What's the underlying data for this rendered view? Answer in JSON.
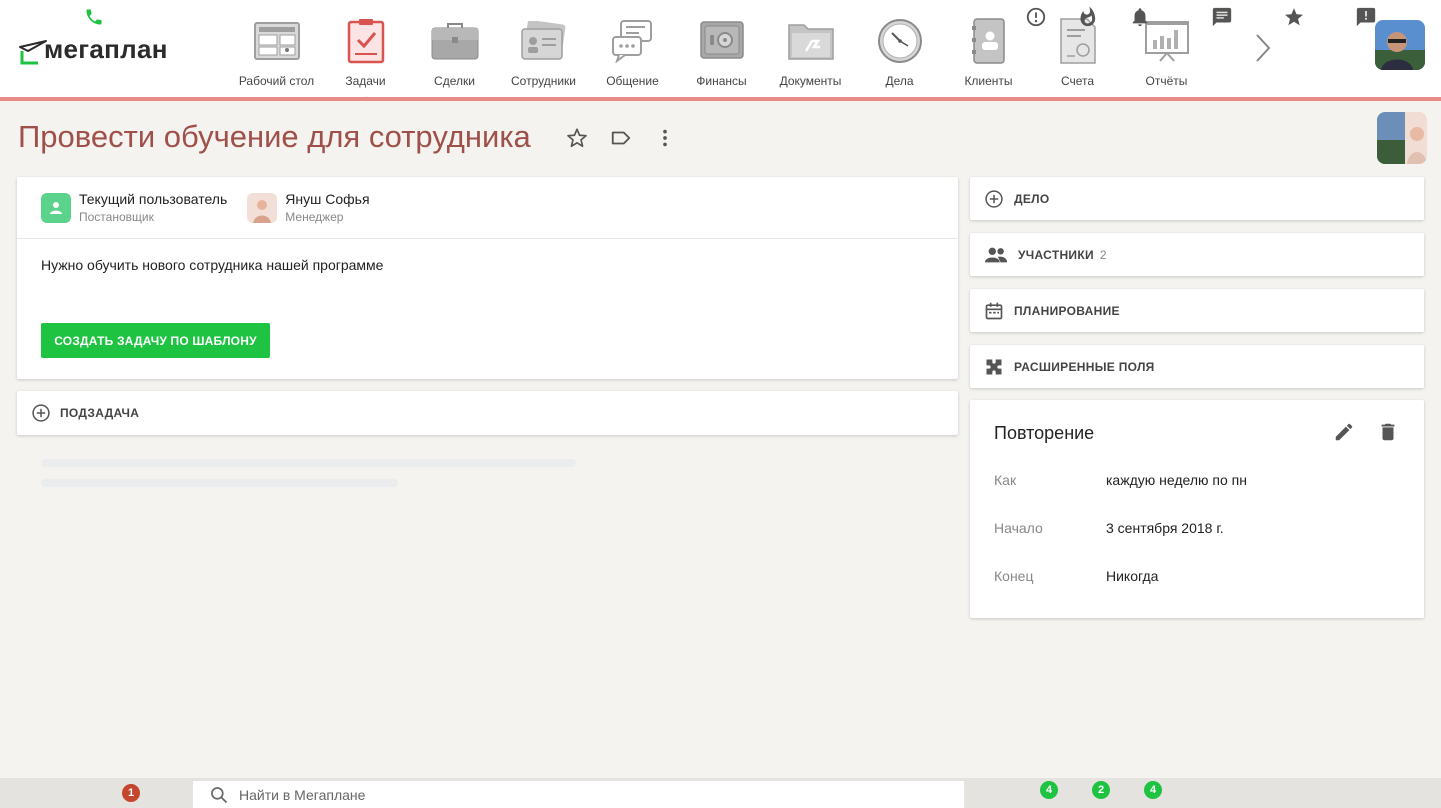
{
  "app": {
    "logo_text": "мегаплан",
    "brand_color": "#1ec342",
    "accent_color": "#e88a86",
    "title_color": "#a0504a"
  },
  "nav": {
    "items": [
      {
        "label": "Рабочий стол",
        "icon": "dashboard-icon"
      },
      {
        "label": "Задачи",
        "icon": "tasks-clipboard-icon",
        "active": true
      },
      {
        "label": "Сделки",
        "icon": "briefcase-icon"
      },
      {
        "label": "Сотрудники",
        "icon": "employee-card-icon"
      },
      {
        "label": "Общение",
        "icon": "chat-bubbles-icon"
      },
      {
        "label": "Финансы",
        "icon": "safe-icon"
      },
      {
        "label": "Документы",
        "icon": "folder-icon"
      },
      {
        "label": "Дела",
        "icon": "clock-icon"
      },
      {
        "label": "Клиенты",
        "icon": "contact-book-icon"
      },
      {
        "label": "Счета",
        "icon": "invoice-icon"
      },
      {
        "label": "Отчёты",
        "icon": "report-chart-icon"
      }
    ]
  },
  "task": {
    "title": "Провести обучение для сотрудника",
    "people": [
      {
        "name": "Текущий пользователь",
        "role": "Постановщик"
      },
      {
        "name": "Януш Софья",
        "role": "Менеджер"
      }
    ],
    "description": "Нужно обучить нового сотрудника нашей программе",
    "template_button": "СОЗДАТЬ ЗАДАЧУ ПО ШАБЛОНУ",
    "subtask_label": "ПОДЗАДАЧА"
  },
  "sidebar": {
    "deal_label": "ДЕЛО",
    "participants_label": "УЧАСТНИКИ",
    "participants_count": "2",
    "planning_label": "ПЛАНИРОВАНИЕ",
    "extended_fields_label": "РАСШИРЕННЫЕ ПОЛЯ"
  },
  "repeat": {
    "title": "Повторение",
    "rows": [
      {
        "key": "Как",
        "value": "каждую неделю по пн"
      },
      {
        "key": "Начало",
        "value": "3 сентября 2018 г."
      },
      {
        "key": "Конец",
        "value": "Никогда"
      }
    ]
  },
  "bottom": {
    "phone_badge": "1",
    "search_placeholder": "Найти в Мегаплане",
    "alerts_badge": "4",
    "hot_badge": "2",
    "notifications_badge": "4"
  }
}
